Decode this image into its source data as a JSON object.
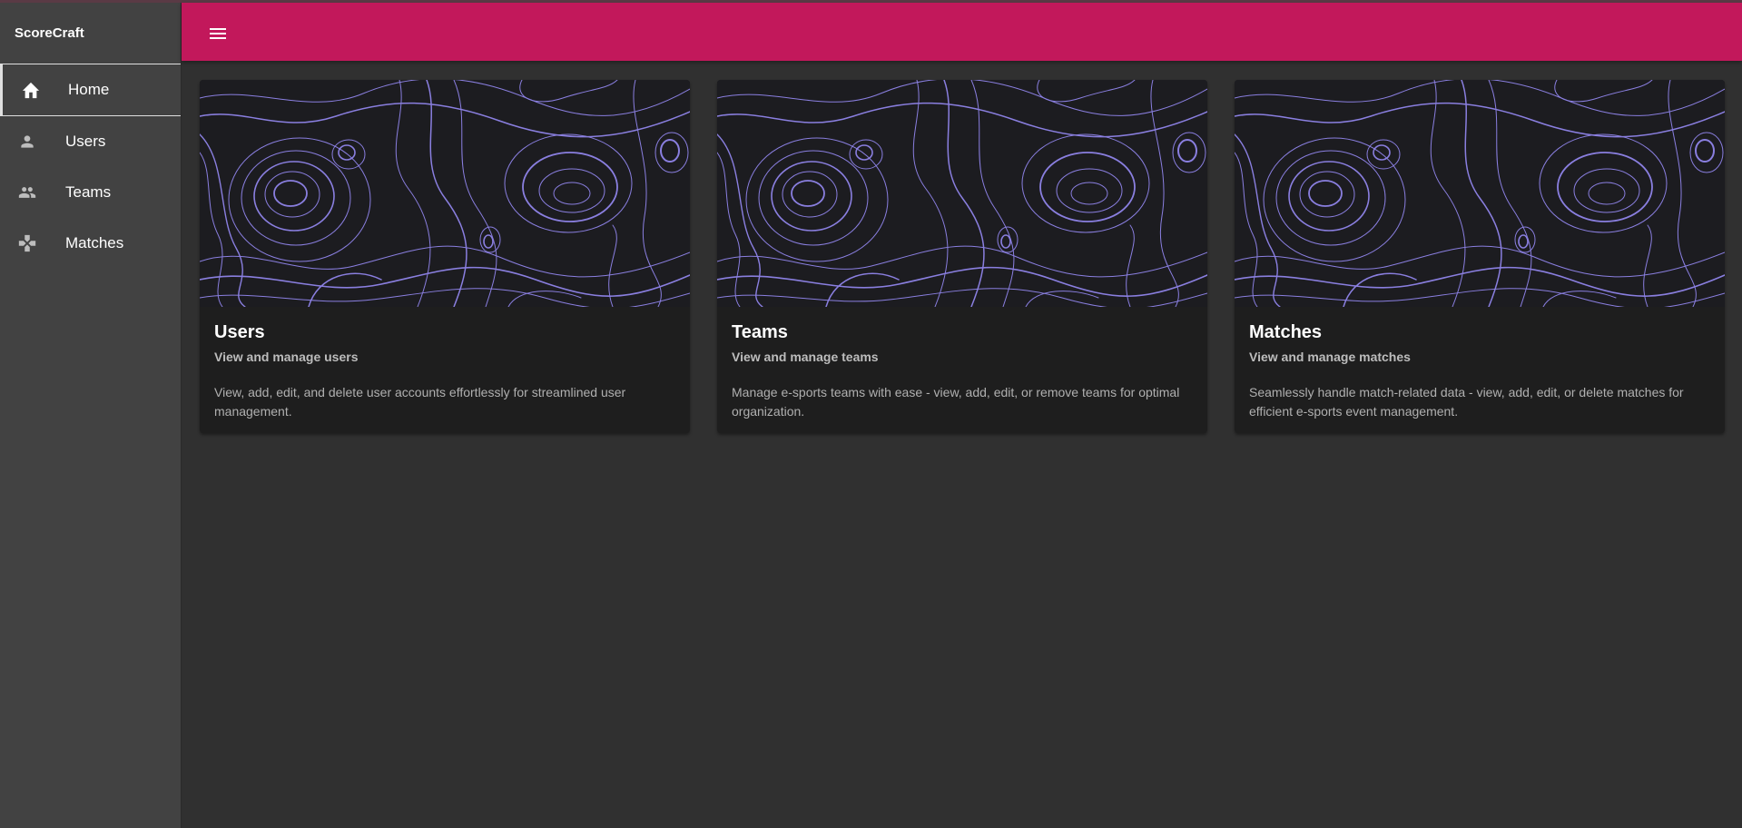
{
  "app": {
    "title": "ScoreCraft"
  },
  "colors": {
    "appbar": "#c2185b",
    "sidebar": "#424242",
    "background": "#303030",
    "card": "#1e1e1e",
    "contour": "#8a7fe0"
  },
  "sidebar": {
    "items": [
      {
        "label": "Home",
        "icon": "home-icon",
        "active": true
      },
      {
        "label": "Users",
        "icon": "person-icon",
        "active": false
      },
      {
        "label": "Teams",
        "icon": "people-icon",
        "active": false
      },
      {
        "label": "Matches",
        "icon": "gamepad-icon",
        "active": false
      }
    ]
  },
  "header": {
    "menu_icon": "menu-icon"
  },
  "cards": [
    {
      "title": "Users",
      "subtitle": "View and manage users",
      "text": "View, add, edit, and delete user accounts effortlessly for streamlined user management."
    },
    {
      "title": "Teams",
      "subtitle": "View and manage teams",
      "text": "Manage e-sports teams with ease - view, add, edit, or remove teams for optimal organization."
    },
    {
      "title": "Matches",
      "subtitle": "View and manage matches",
      "text": "Seamlessly handle match-related data - view, add, edit, or delete matches for efficient e-sports event management."
    }
  ]
}
